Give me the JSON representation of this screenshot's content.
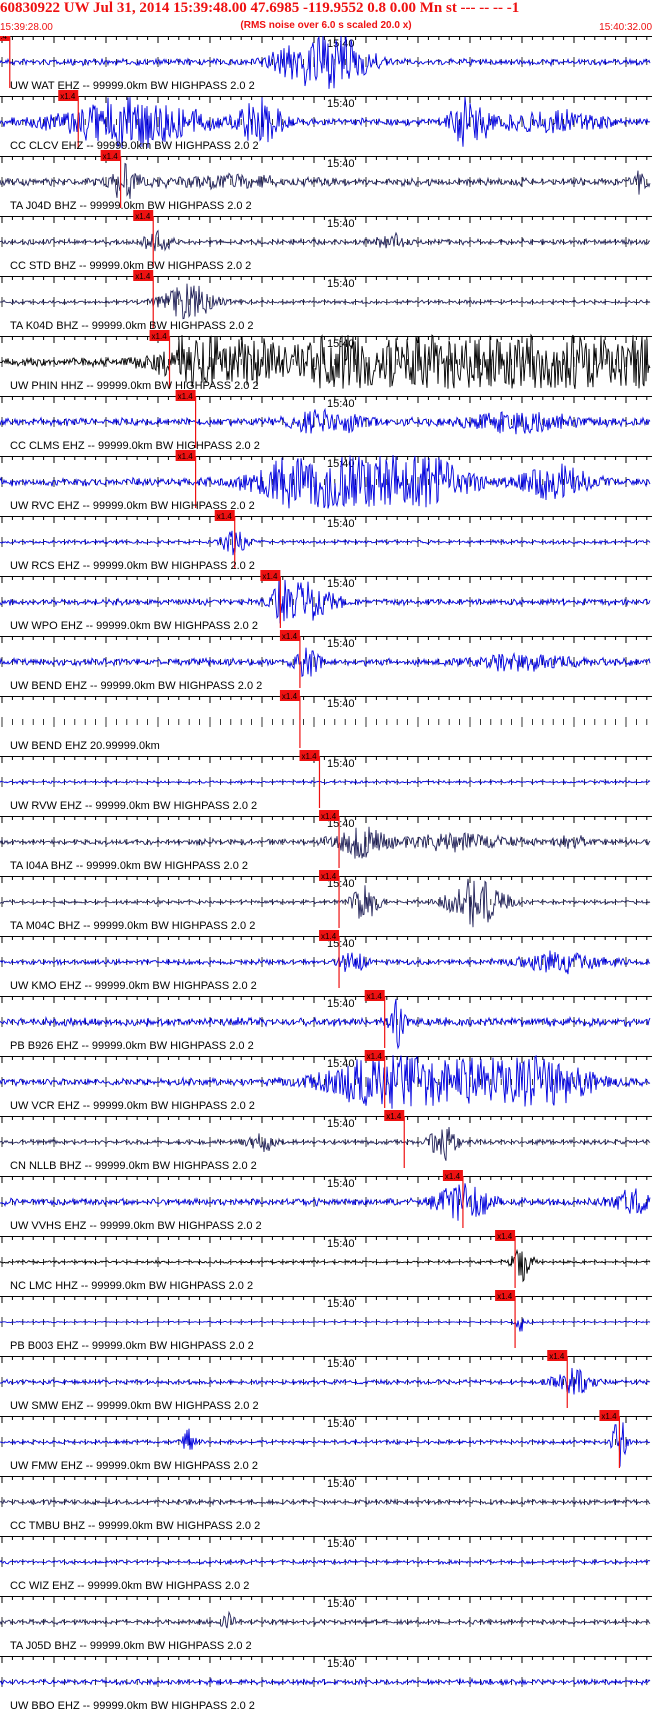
{
  "header": {
    "title": "60830922 UW Jul 31, 2014 15:39:48.00    47.6985 -119.9552  0.8 0.00 Mn st --- -- --   -1",
    "subtitle": "(RMS noise over 6.0 s scaled 20.0 x)",
    "start_time": "15:39:28.00",
    "end_time": "15:40:32.00"
  },
  "minute_label": "15:40",
  "pick_label": "x1.4",
  "colors": {
    "accent_red": "#ee1111",
    "trace_blue": "#0000dd",
    "trace_navy": "#23235a",
    "trace_black": "#000000"
  },
  "traces": [
    {
      "label": "UW WAT EHZ -- 99999.0km BW  HIGHPASS  2.0  2",
      "color": "#0000dd",
      "pick": 0.015,
      "amp": 0.35,
      "bursts": [
        [
          0.48,
          0.06,
          2.5
        ],
        [
          0.52,
          0.05,
          1.8
        ]
      ]
    },
    {
      "label": "CC CLCV EHZ -- 99999.0km BW  HIGHPASS  2.0  2",
      "color": "#0000dd",
      "pick": 0.12,
      "amp": 0.4,
      "bursts": [
        [
          0.2,
          0.1,
          3.2
        ],
        [
          0.4,
          0.03,
          3.0
        ],
        [
          0.72,
          0.03,
          3.2
        ],
        [
          0.85,
          0.08,
          1.2
        ]
      ]
    },
    {
      "label": "TA J04D BHZ -- 99999.0km BW  HIGHPASS  2.0  2",
      "color": "#23235a",
      "pick": 0.185,
      "amp": 0.4,
      "bursts": [
        [
          0.19,
          0.02,
          2.2
        ],
        [
          0.35,
          0.1,
          0.6
        ],
        [
          0.98,
          0.01,
          2.0
        ]
      ]
    },
    {
      "label": "CC STD BHZ -- 99999.0km BW  HIGHPASS  2.0  2",
      "color": "#23235a",
      "pick": 0.235,
      "amp": 0.3,
      "bursts": [
        [
          0.24,
          0.02,
          1.2
        ],
        [
          0.6,
          0.02,
          1.0
        ]
      ]
    },
    {
      "label": "TA K04D BHZ -- 99999.0km BW  HIGHPASS  2.0  2",
      "color": "#23235a",
      "pick": 0.235,
      "amp": 0.2,
      "bursts": [
        [
          0.29,
          0.04,
          2.2
        ]
      ]
    },
    {
      "label": "UW PHIN HHZ -- 99999.0km BW  HIGHPASS  2.0  2",
      "color": "#000000",
      "pick": 0.26,
      "amp": 0.5,
      "bursts": [
        [
          0.33,
          0.07,
          5
        ],
        [
          0.62,
          0.15,
          6
        ],
        [
          0.85,
          0.12,
          6
        ],
        [
          0.98,
          0.06,
          6
        ]
      ]
    },
    {
      "label": "CC CLMS EHZ -- 99999.0km BW  HIGHPASS  2.0  2",
      "color": "#0000dd",
      "pick": 0.3,
      "amp": 0.45,
      "bursts": [
        [
          0.5,
          0.06,
          1.3
        ],
        [
          0.8,
          0.08,
          1.1
        ]
      ]
    },
    {
      "label": "UW RVC EHZ -- 99999.0km BW  HIGHPASS  2.0  2",
      "color": "#0000dd",
      "pick": 0.3,
      "amp": 0.45,
      "bursts": [
        [
          0.48,
          0.08,
          4
        ],
        [
          0.63,
          0.08,
          3.6
        ],
        [
          0.85,
          0.05,
          2
        ]
      ]
    },
    {
      "label": "UW RCS EHZ -- 99999.0km BW  HIGHPASS  2.0  2",
      "color": "#0000dd",
      "pick": 0.36,
      "amp": 0.2,
      "bursts": [
        [
          0.36,
          0.02,
          1.6
        ]
      ]
    },
    {
      "label": "UW WPO EHZ -- 99999.0km BW  HIGHPASS  2.0  2",
      "color": "#0000dd",
      "pick": 0.43,
      "amp": 0.35,
      "bursts": [
        [
          0.43,
          0.01,
          3.5
        ],
        [
          0.47,
          0.04,
          2.5
        ]
      ]
    },
    {
      "label": "UW BEND EHZ -- 99999.0km BW  HIGHPASS  2.0  2",
      "color": "#0000dd",
      "pick": 0.46,
      "amp": 0.4,
      "bursts": [
        [
          0.47,
          0.02,
          1.6
        ],
        [
          0.8,
          0.08,
          0.8
        ]
      ]
    },
    {
      "label": "UW BEND EHZ 20.99999.0km",
      "color": "#0000dd",
      "pick": 0.46,
      "amp": 0,
      "bursts": []
    },
    {
      "label": "UW RVW EHZ -- 99999.0km BW  HIGHPASS  2.0  2",
      "color": "#0000dd",
      "pick": 0.49,
      "amp": 0.15,
      "bursts": []
    },
    {
      "label": "TA I04A BHZ -- 99999.0km BW  HIGHPASS  2.0  2",
      "color": "#23235a",
      "pick": 0.52,
      "amp": 0.3,
      "bursts": [
        [
          0.55,
          0.04,
          1.8
        ],
        [
          0.7,
          0.08,
          1.0
        ],
        [
          0.88,
          0.03,
          0.8
        ]
      ]
    },
    {
      "label": "TA M04C BHZ -- 99999.0km BW  HIGHPASS  2.0  2",
      "color": "#23235a",
      "pick": 0.52,
      "amp": 0.2,
      "bursts": [
        [
          0.56,
          0.02,
          2.4
        ],
        [
          0.73,
          0.04,
          3.2
        ]
      ]
    },
    {
      "label": "UW KMO EHZ -- 99999.0km BW  HIGHPASS  2.0  2",
      "color": "#0000dd",
      "pick": 0.52,
      "amp": 0.3,
      "bursts": [
        [
          0.54,
          0.02,
          1.6
        ],
        [
          0.86,
          0.06,
          1.2
        ]
      ]
    },
    {
      "label": "PB B926 EHZ -- 99999.0km BW  HIGHPASS  2.0  2",
      "color": "#0000dd",
      "pick": 0.59,
      "amp": 0.5,
      "bursts": [
        [
          0.61,
          0.01,
          3
        ]
      ]
    },
    {
      "label": "UW VCR EHZ -- 99999.0km BW  HIGHPASS  2.0  2",
      "color": "#0000dd",
      "pick": 0.59,
      "amp": 0.4,
      "bursts": [
        [
          0.62,
          0.1,
          4.5
        ],
        [
          0.78,
          0.1,
          5
        ]
      ]
    },
    {
      "label": "CN NLLB BHZ -- 99999.0km BW  HIGHPASS  2.0  2",
      "color": "#23235a",
      "pick": 0.62,
      "amp": 0.25,
      "bursts": [
        [
          0.68,
          0.02,
          2.2
        ],
        [
          0.4,
          0.02,
          1.2
        ]
      ]
    },
    {
      "label": "UW VVHS EHZ -- 99999.0km BW  HIGHPASS  2.0  2",
      "color": "#0000dd",
      "pick": 0.71,
      "amp": 0.4,
      "bursts": [
        [
          0.71,
          0.04,
          2.2
        ],
        [
          0.97,
          0.03,
          1.5
        ]
      ]
    },
    {
      "label": "NC LMC HHZ -- 99999.0km BW  HIGHPASS  2.0  2",
      "color": "#000000",
      "pick": 0.79,
      "amp": 0.15,
      "bursts": [
        [
          0.8,
          0.015,
          2.4
        ]
      ]
    },
    {
      "label": "PB B003 EHZ -- 99999.0km BW  HIGHPASS  2.0  2",
      "color": "#0000dd",
      "pick": 0.79,
      "amp": 0.08,
      "bursts": [
        [
          0.8,
          0.01,
          1.2
        ]
      ]
    },
    {
      "label": "UW SMW EHZ -- 99999.0km BW  HIGHPASS  2.0  2",
      "color": "#0000dd",
      "pick": 0.87,
      "amp": 0.25,
      "bursts": [
        [
          0.88,
          0.03,
          1.5
        ]
      ]
    },
    {
      "label": "UW FMW EHZ -- 99999.0km BW  HIGHPASS  2.0  2",
      "color": "#0000dd",
      "pick": 0.95,
      "amp": 0.2,
      "bursts": [
        [
          0.29,
          0.01,
          1.6
        ],
        [
          0.95,
          0.01,
          3.2
        ]
      ]
    },
    {
      "label": "CC TMBU BHZ -- 99999.0km BW  HIGHPASS  2.0  2",
      "color": "#23235a",
      "pick": null,
      "amp": 0.25,
      "bursts": []
    },
    {
      "label": "CC WIZ EHZ -- 99999.0km BW  HIGHPASS  2.0  2",
      "color": "#0000dd",
      "pick": null,
      "amp": 0.2,
      "bursts": []
    },
    {
      "label": "TA J05D BHZ -- 99999.0km BW  HIGHPASS  2.0  2",
      "color": "#23235a",
      "pick": null,
      "amp": 0.25,
      "bursts": [
        [
          0.35,
          0.01,
          1.2
        ]
      ]
    },
    {
      "label": "UW BBO EHZ -- 99999.0km BW  HIGHPASS  2.0  2",
      "color": "#0000dd",
      "pick": null,
      "amp": 0.3,
      "bursts": []
    }
  ]
}
